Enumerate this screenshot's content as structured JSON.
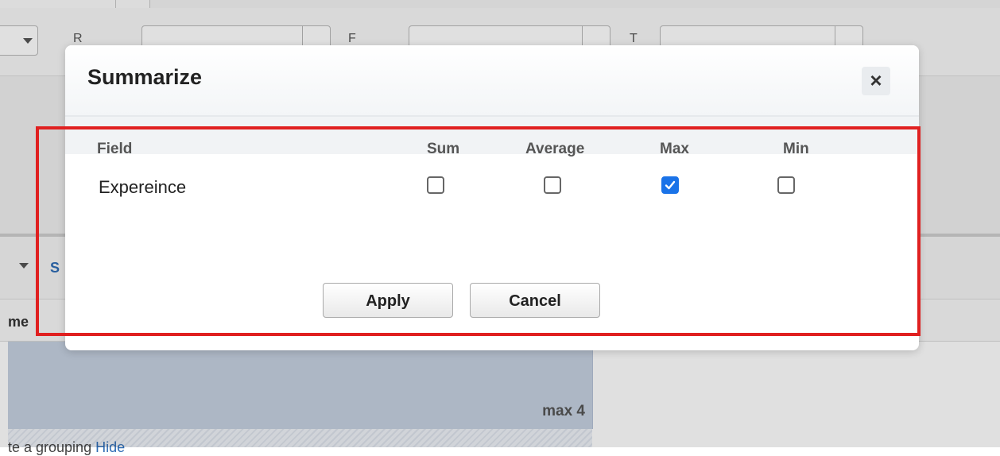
{
  "dialog": {
    "title": "Summarize",
    "close_label": "×"
  },
  "table": {
    "headers": {
      "field": "Field",
      "sum": "Sum",
      "average": "Average",
      "max": "Max",
      "min": "Min"
    },
    "rows": [
      {
        "field": "Expereince",
        "sum": false,
        "average": false,
        "max": true,
        "min": false
      }
    ]
  },
  "buttons": {
    "apply": "Apply",
    "cancel": "Cancel"
  },
  "background": {
    "link_text": "S",
    "column_header_text": "me",
    "summary_value": "max 4",
    "footer_text_1": "te a grouping",
    "footer_text_2": "Hide"
  },
  "colors": {
    "accent": "#1a73e8",
    "highlight_border": "#e02020",
    "summary_band": "#c5d1e1"
  }
}
